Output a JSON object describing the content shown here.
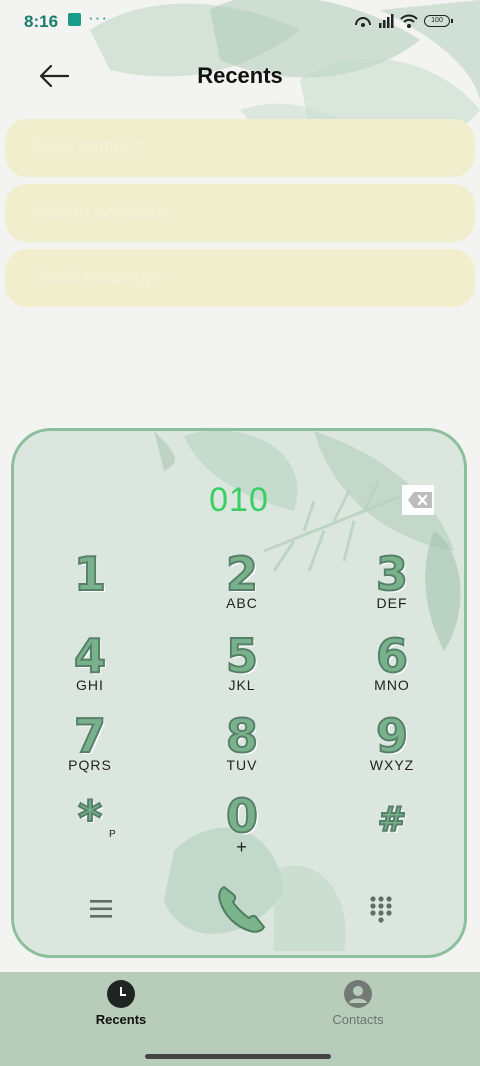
{
  "status_bar": {
    "time": "8:16",
    "more": "···",
    "battery": "100"
  },
  "header": {
    "title": "Recents"
  },
  "actions": [
    {
      "label": "New contact"
    },
    {
      "label": "Add to contacts"
    },
    {
      "label": "Send message"
    }
  ],
  "dialpad": {
    "number": "010",
    "keys": [
      {
        "digit": "1",
        "letters": ""
      },
      {
        "digit": "2",
        "letters": "ABC"
      },
      {
        "digit": "3",
        "letters": "DEF"
      },
      {
        "digit": "4",
        "letters": "GHI"
      },
      {
        "digit": "5",
        "letters": "JKL"
      },
      {
        "digit": "6",
        "letters": "MNO"
      },
      {
        "digit": "7",
        "letters": "PQRS"
      },
      {
        "digit": "8",
        "letters": "TUV"
      },
      {
        "digit": "9",
        "letters": "WXYZ"
      },
      {
        "digit": "*",
        "letters": "P"
      },
      {
        "digit": "0",
        "letters": "+"
      },
      {
        "digit": "#",
        "letters": ""
      }
    ]
  },
  "bottom_nav": {
    "tabs": [
      {
        "label": "Recents",
        "icon": "clock-icon",
        "active": true
      },
      {
        "label": "Contacts",
        "icon": "person-icon",
        "active": false
      }
    ]
  },
  "colors": {
    "accent_green": "#39cf62",
    "dialpad_border": "#8cbf9c",
    "dialpad_bg": "#dbe6df",
    "nav_bg": "#b8cdb9",
    "action_bg": "#f1eece"
  }
}
